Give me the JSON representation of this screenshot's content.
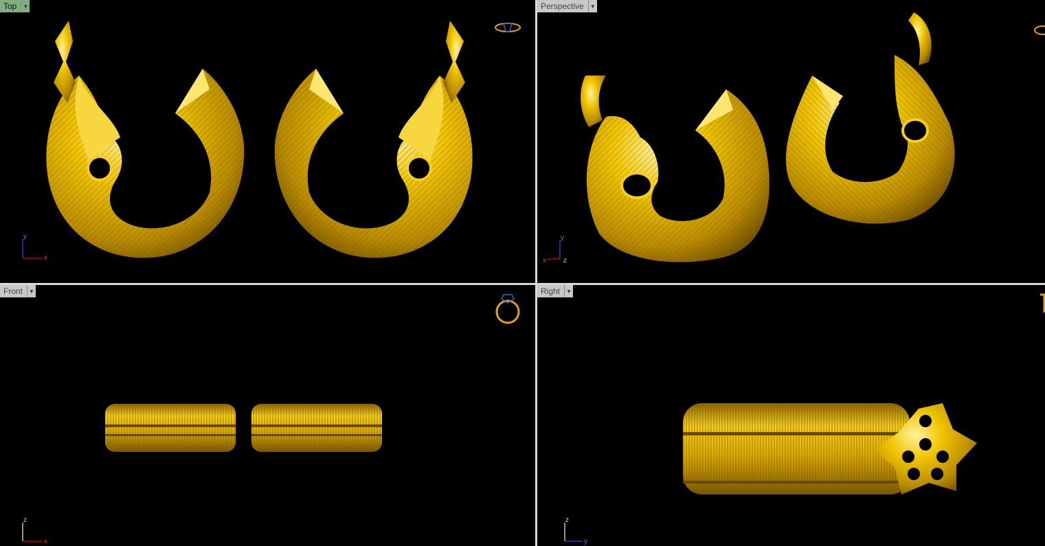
{
  "viewports": {
    "top": {
      "label": "Top",
      "axes": [
        "y",
        "x"
      ]
    },
    "perspective": {
      "label": "Perspective",
      "axes": [
        "y",
        "x",
        "z"
      ]
    },
    "front": {
      "label": "Front",
      "axes": [
        "z",
        "x"
      ]
    },
    "right": {
      "label": "Right",
      "axes": [
        "z",
        "y"
      ]
    }
  },
  "icons": {
    "dropdown": "triangle-down-icon",
    "ring": "ring-icon",
    "axis": "axis-gizmo-icon"
  },
  "colors": {
    "gold": "#e6b800",
    "gold_dark": "#8a6400",
    "active_label": "#7fb07f",
    "axis_x": "#c00000",
    "axis_y": "#2040c0",
    "axis_z": "#c0c0c0"
  }
}
